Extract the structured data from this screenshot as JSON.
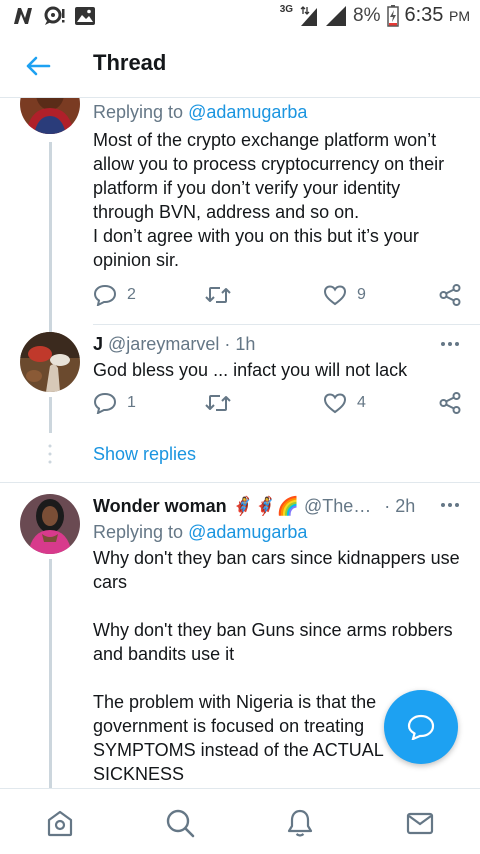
{
  "status_bar": {
    "network": "3G",
    "battery_percent": "8%",
    "time": "6:35",
    "ampm": "PM"
  },
  "header": {
    "title": "Thread"
  },
  "tweets": [
    {
      "reply_prefix": "Replying to ",
      "reply_handle": "@adamugarba",
      "text": "Most of the crypto exchange platform won’t allow you to process cryptocurrency on their platform if you don’t verify your identity through BVN, address and so on.\nI don’t agree with you on this but it’s your opinion sir.",
      "replies": "2",
      "likes": "9"
    },
    {
      "name": "J",
      "handle": "@jareymarvel",
      "time": "· 1h",
      "text": "God bless you ... infact you will not lack",
      "replies": "1",
      "likes": "4"
    },
    {
      "name": "Wonder woman",
      "emoji": "🦸‍♀️🦸‍♀️🌈",
      "handle": "@The…",
      "time": "· 2h",
      "reply_prefix": "Replying to ",
      "reply_handle": "@adamugarba",
      "text": "Why don't they ban cars since kidnappers use cars\n\nWhy don't they ban Guns since arms robbers and bandits use it\n\nThe problem with Nigeria is that the government is focused on treating SYMPTOMS instead of the ACTUAL SICKNESS"
    }
  ],
  "show_replies": "Show replies",
  "colors": {
    "accent": "#1da1f2",
    "link": "#1b95e0",
    "muted": "#657786",
    "thread_line": "#ccd6dd"
  }
}
